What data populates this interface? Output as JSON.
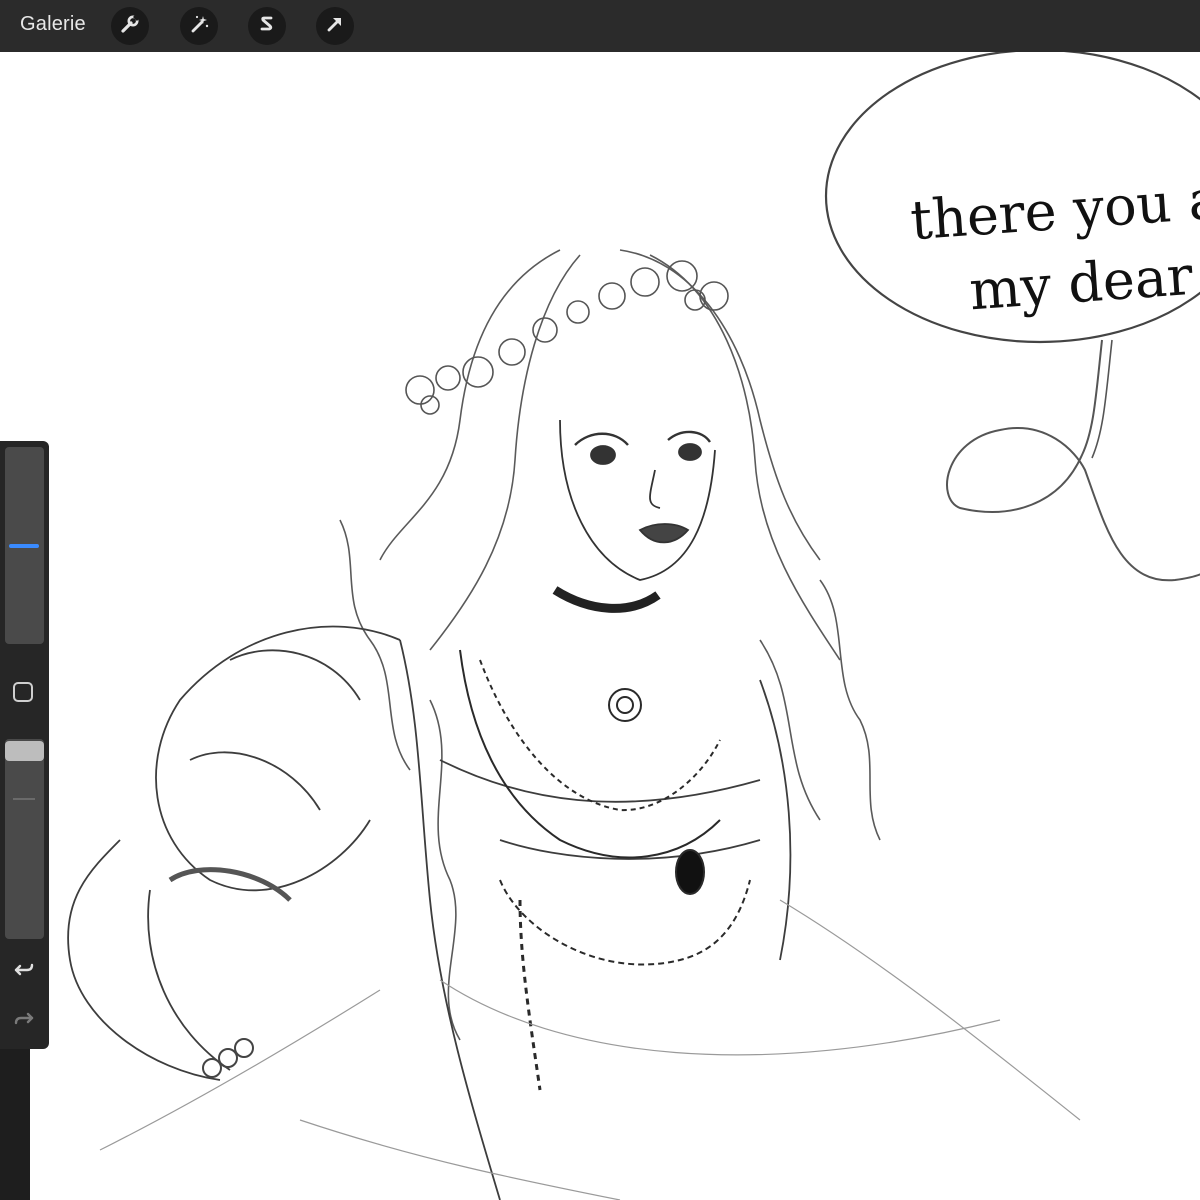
{
  "topbar": {
    "gallery_label": "Galerie",
    "tools": [
      {
        "name": "actions",
        "icon": "wrench-icon"
      },
      {
        "name": "adjustments",
        "icon": "magic-wand-icon"
      },
      {
        "name": "selection",
        "icon": "selection-s-icon"
      },
      {
        "name": "transform",
        "icon": "arrow-cursor-icon"
      }
    ]
  },
  "canvas": {
    "speech_bubble": {
      "line1": "there you ar",
      "line2": "my dear !"
    }
  },
  "sidebar": {
    "brush_size_level": 0.5,
    "brush_opacity_level": 1.0,
    "accent_color": "#3a8bff",
    "icons": [
      "modifier-square-icon",
      "undo-arrow-icon",
      "redo-arrow-icon"
    ]
  },
  "colors": {
    "toolbar_bg": "#2b2b2b",
    "sidebar_bg": "#262626",
    "canvas_bg": "#ffffff"
  }
}
